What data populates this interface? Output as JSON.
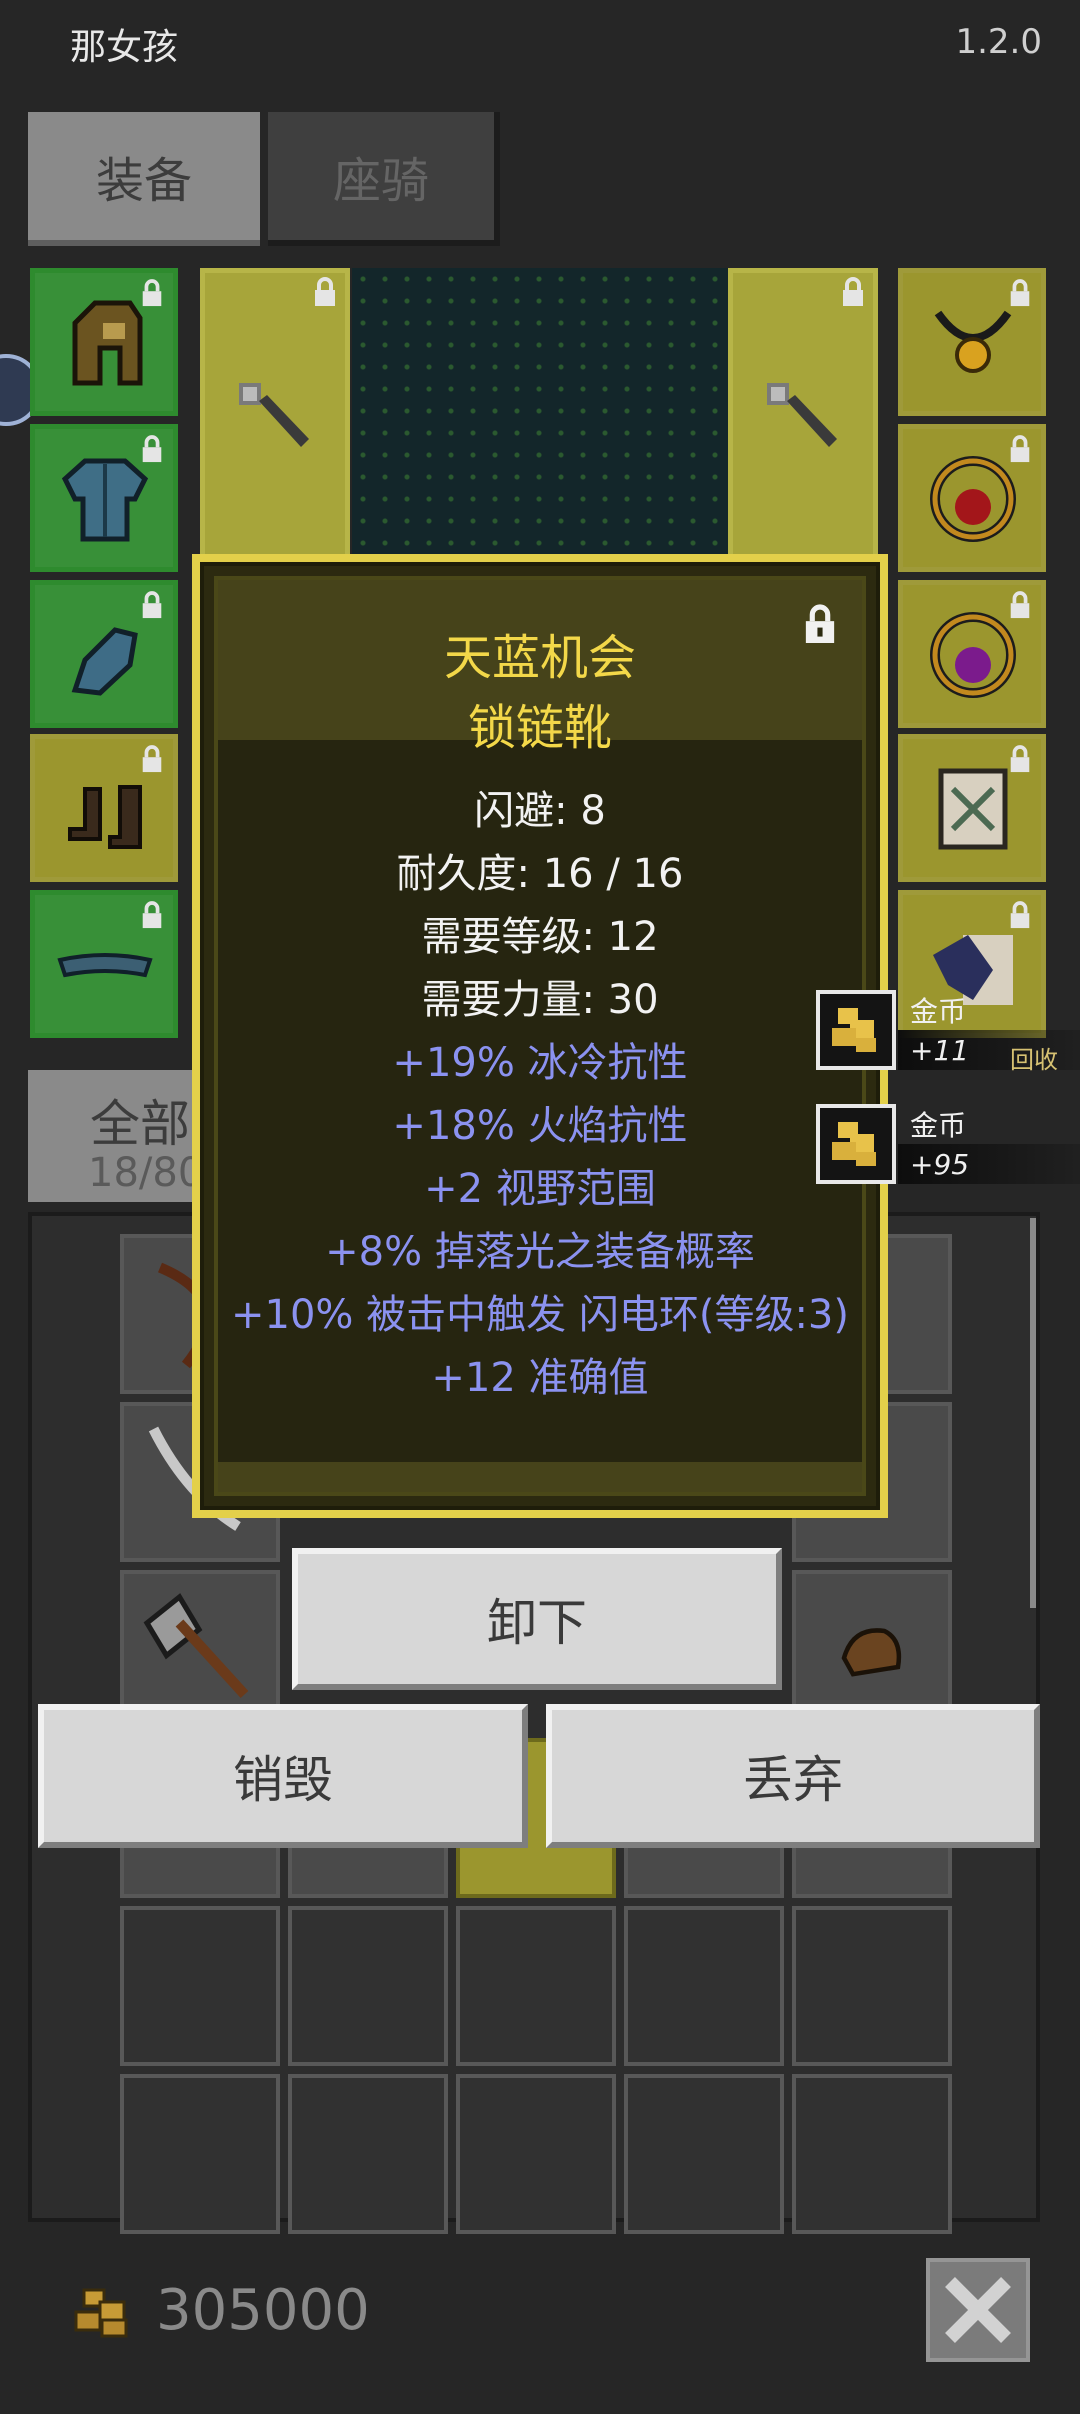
{
  "header": {
    "title": "那女孩",
    "version": "1.2.0"
  },
  "tabs": [
    {
      "label": "装备",
      "active": true
    },
    {
      "label": "座骑",
      "active": false
    }
  ],
  "tooltip": {
    "item_name": "天蓝机会",
    "item_type": "锁链靴",
    "base_stats": [
      "闪避: 8",
      "耐久度: 16 / 16",
      "需要等级: 12",
      "需要力量: 30"
    ],
    "magic_affixes": [
      "+19% 冰冷抗性",
      "+18% 火焰抗性",
      "+2 视野范围",
      "+8% 掉落光之装备概率",
      "+10% 被击中触发 闪电环(等级:3)",
      "+12 准确值"
    ],
    "name_color": "#f3d849",
    "affix_color": "#8b92f0"
  },
  "actions": {
    "unequip": "卸下",
    "destroy": "销毁",
    "drop": "丢弃"
  },
  "category_tab": {
    "label": "全部",
    "count": "18/80"
  },
  "notifications": [
    {
      "name": "金币",
      "amount": "+11",
      "extra": "回收",
      "icon": "gold-coins-icon"
    },
    {
      "name": "金币",
      "amount": "+95",
      "icon": "gold-coins-icon"
    }
  ],
  "footer": {
    "gold": "305000",
    "icon": "gold-coins-icon",
    "close_icon": "close-x-icon"
  }
}
